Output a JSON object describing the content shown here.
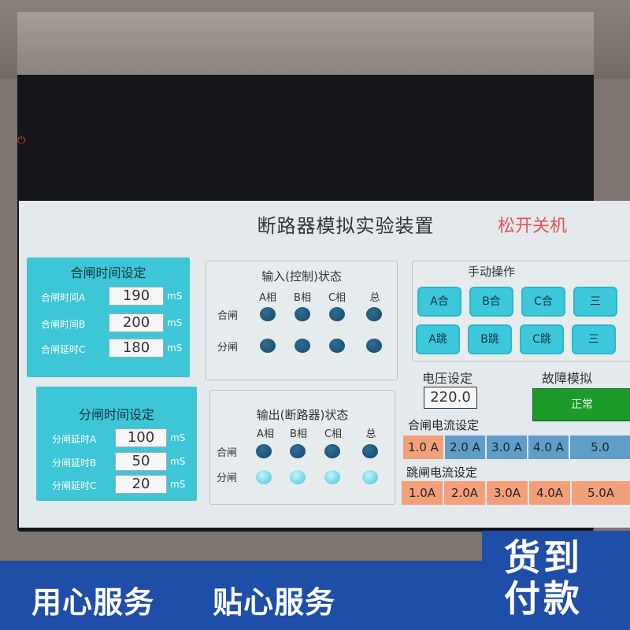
{
  "screen": {
    "title": "断路器模拟实验装置",
    "shutdown_label": "松开关机"
  },
  "close_time_panel": {
    "title": "合闸时间设定",
    "rows": [
      {
        "label": "合闸时间A",
        "value": "190",
        "unit": "mS"
      },
      {
        "label": "合闸时间B",
        "value": "200",
        "unit": "mS"
      },
      {
        "label": "合闸延时C",
        "value": "180",
        "unit": "mS"
      }
    ]
  },
  "open_time_panel": {
    "title": "分闸时间设定",
    "rows": [
      {
        "label": "分闸延时A",
        "value": "100",
        "unit": "mS"
      },
      {
        "label": "分闸延时B",
        "value": "50",
        "unit": "mS"
      },
      {
        "label": "分闸延时C",
        "value": "20",
        "unit": "mS"
      }
    ]
  },
  "input_status": {
    "title": "输入(控制)状态",
    "columns": [
      "A相",
      "B相",
      "C相",
      "总"
    ],
    "rows": [
      "合闸",
      "分闸"
    ]
  },
  "output_status": {
    "title": "输出(断路器)状态",
    "columns": [
      "A相",
      "B相",
      "C相",
      "总"
    ],
    "rows": [
      "合闸",
      "分闸"
    ]
  },
  "manual": {
    "title": "手动操作",
    "close_buttons": [
      "A合",
      "B合",
      "C合",
      "三"
    ],
    "trip_buttons": [
      "A跳",
      "B跳",
      "C跳",
      "三"
    ]
  },
  "voltage": {
    "label": "电压设定",
    "value": "220.0"
  },
  "fault": {
    "label": "故障模拟",
    "status": "正常"
  },
  "close_current": {
    "label": "合闸电流设定",
    "options": [
      "1.0 A",
      "2.0 A",
      "3.0 A",
      "4.0 A",
      "5.0"
    ]
  },
  "trip_current": {
    "label": "跳闸电流设定",
    "options": [
      "1.0A",
      "2.0A",
      "3.0A",
      "4.0A",
      "5.0A"
    ]
  },
  "banner": {
    "slogan_1": "用心服务",
    "slogan_2": "贴心服务",
    "badge_line1": "货到",
    "badge_line2": "付款"
  },
  "colors": {
    "panel_cyan": "#3dc6d6",
    "lamp_dark": "#174466",
    "lamp_lit": "#49c2d4",
    "current_selected": "#f2a07a",
    "current_unselected": "#5f9ec8",
    "fault_normal": "#1c9a2a",
    "banner_blue": "#1f4ea8"
  }
}
